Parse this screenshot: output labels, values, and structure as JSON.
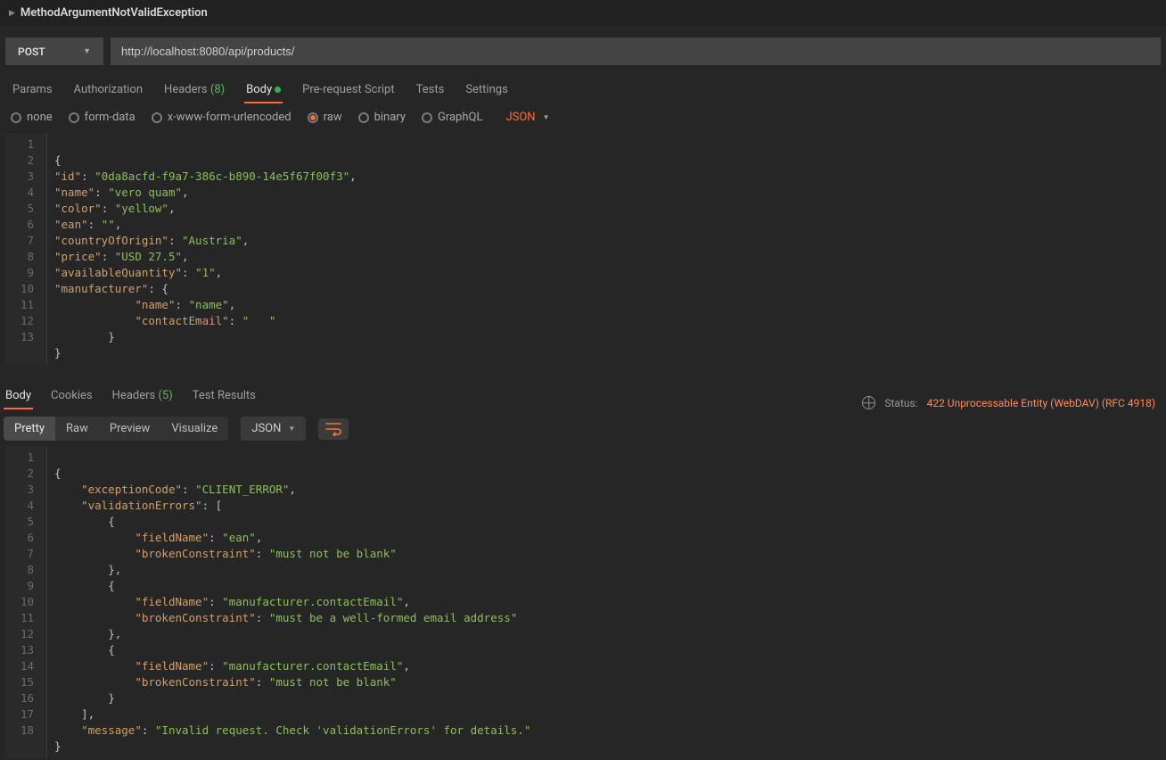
{
  "titlebar": {
    "title": "MethodArgumentNotValidException"
  },
  "request": {
    "method": "POST",
    "url": "http://localhost:8080/api/products/"
  },
  "tabs": {
    "params": "Params",
    "auth": "Authorization",
    "headers": "Headers",
    "headers_count": "(8)",
    "body": "Body",
    "prereq": "Pre-request Script",
    "tests": "Tests",
    "settings": "Settings"
  },
  "bodytypes": {
    "none": "none",
    "formdata": "form-data",
    "urlenc": "x-www-form-urlencoded",
    "raw": "raw",
    "binary": "binary",
    "graphql": "GraphQL",
    "format": "JSON"
  },
  "reqbody": {
    "l1": "{",
    "l2_k": "\"id\"",
    "l2_v": "\"0da8acfd-f9a7-386c-b890-14e5f67f00f3\"",
    "l3_k": "\"name\"",
    "l3_v": "\"vero quam\"",
    "l4_k": "\"color\"",
    "l4_v": "\"yellow\"",
    "l5_k": "\"ean\"",
    "l5_v": "\"\"",
    "l6_k": "\"countryOfOrigin\"",
    "l6_v": "\"Austria\"",
    "l7_k": "\"price\"",
    "l7_v": "\"USD 27.5\"",
    "l8_k": "\"availableQuantity\"",
    "l8_v": "\"1\"",
    "l9_k": "\"manufacturer\"",
    "l9_v": "{",
    "l10_k": "\"name\"",
    "l10_v": "\"name\"",
    "l11_k": "\"contactEmail\"",
    "l11_v": "\"   \"",
    "l12": "        }",
    "l13": "}"
  },
  "resptabs": {
    "body": "Body",
    "cookies": "Cookies",
    "headers": "Headers",
    "headers_count": "(5)",
    "testresults": "Test Results"
  },
  "status": {
    "label": "Status:",
    "value": "422 Unprocessable Entity (WebDAV) (RFC 4918)"
  },
  "view": {
    "pretty": "Pretty",
    "raw": "Raw",
    "preview": "Preview",
    "visualize": "Visualize",
    "format": "JSON"
  },
  "respbody": {
    "l1": "{",
    "l2_k": "\"exceptionCode\"",
    "l2_v": "\"CLIENT_ERROR\"",
    "l3_k": "\"validationErrors\"",
    "l4": "        {",
    "l5_k": "\"fieldName\"",
    "l5_v": "\"ean\"",
    "l6_k": "\"brokenConstraint\"",
    "l6_v": "\"must not be blank\"",
    "l7": "        },",
    "l8": "        {",
    "l9_k": "\"fieldName\"",
    "l9_v": "\"manufacturer.contactEmail\"",
    "l10_k": "\"brokenConstraint\"",
    "l10_v": "\"must be a well-formed email address\"",
    "l11": "        },",
    "l12": "        {",
    "l13_k": "\"fieldName\"",
    "l13_v": "\"manufacturer.contactEmail\"",
    "l14_k": "\"brokenConstraint\"",
    "l14_v": "\"must not be blank\"",
    "l15": "        }",
    "l16": "    ],",
    "l17_k": "\"message\"",
    "l17_v": "\"Invalid request. Check 'validationErrors' for details.\"",
    "l18": "}"
  }
}
